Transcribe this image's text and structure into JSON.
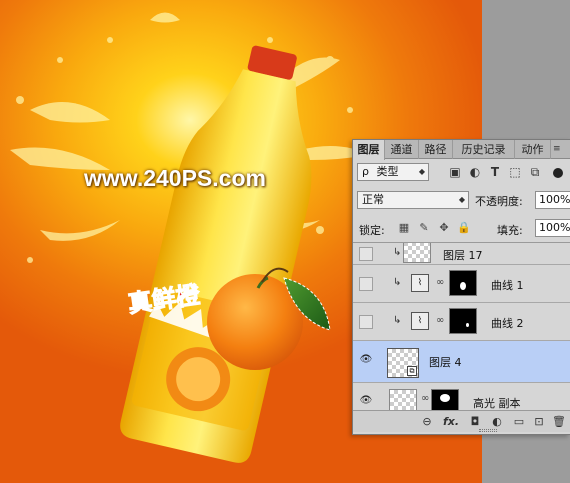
{
  "canvas": {
    "watermark": "www.240PS.com",
    "bottle_label_text": "真鲜橙"
  },
  "layers_panel": {
    "tabs": [
      {
        "label": "图层",
        "active": true
      },
      {
        "label": "通道",
        "active": false
      },
      {
        "label": "路径",
        "active": false
      },
      {
        "label": "历史记录",
        "active": false
      },
      {
        "label": "动作",
        "active": false
      }
    ],
    "filter": {
      "search_glyph": "ρ",
      "kind_label": "类型"
    },
    "blend_mode": "正常",
    "opacity_label": "不透明度:",
    "opacity_value": "100%",
    "lock_label": "锁定:",
    "fill_label": "填充:",
    "fill_value": "100%",
    "layers": [
      {
        "name": "图层 17",
        "visible": false,
        "clipped": true,
        "selected": false
      },
      {
        "name": "曲线 1",
        "visible": false,
        "clipped": true,
        "selected": false
      },
      {
        "name": "曲线 2",
        "visible": false,
        "clipped": true,
        "selected": false
      },
      {
        "name": "图层 4",
        "visible": true,
        "clipped": false,
        "selected": true
      },
      {
        "name": "高光 副本",
        "visible": true,
        "clipped": false,
        "selected": false
      }
    ],
    "bottom_bar": {
      "fx_label": "fx."
    }
  },
  "colors": {
    "selected_layer": "#b9cff6",
    "panel_bg": "#d6d6d6",
    "canvas_orange": "#ef7a0c"
  }
}
